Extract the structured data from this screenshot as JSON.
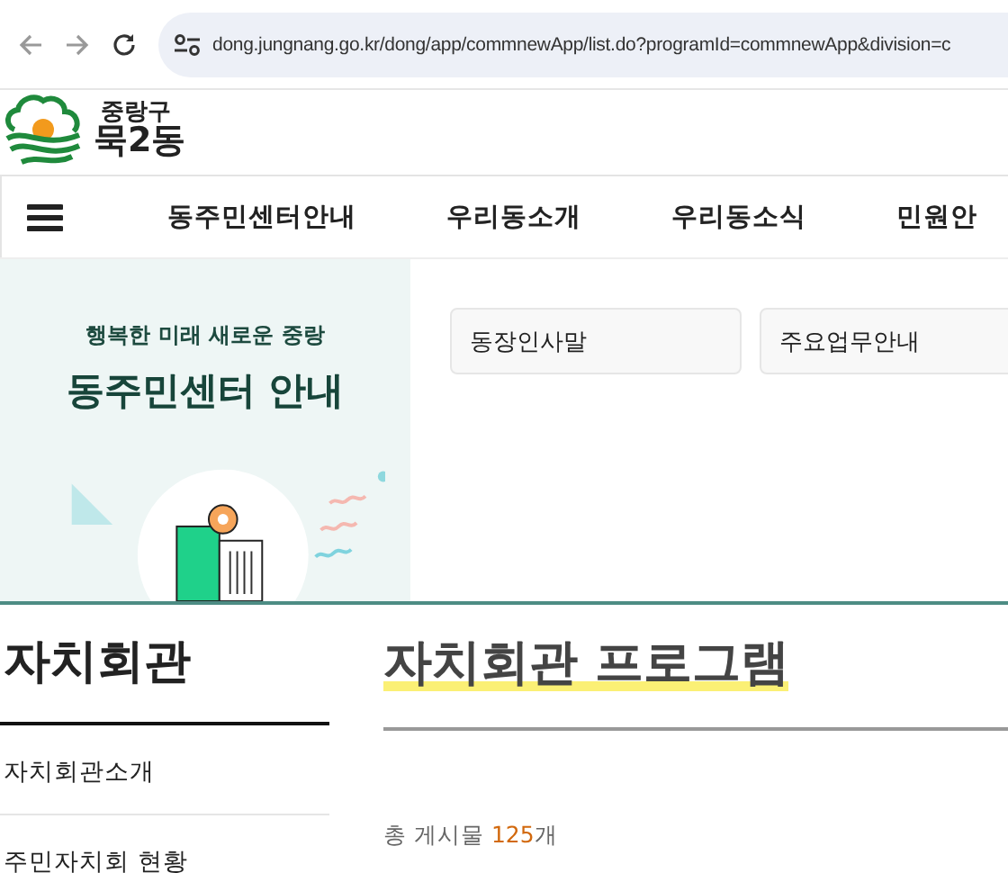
{
  "browser": {
    "url": "dong.jungnang.go.kr/dong/app/commnewApp/list.do?programId=commnewApp&division=c"
  },
  "header": {
    "district": "중랑구",
    "dong": "묵2동"
  },
  "nav": {
    "items": [
      "동주민센터안내",
      "우리동소개",
      "우리동소식",
      "민원안"
    ]
  },
  "banner": {
    "subtitle": "행복한 미래 새로운 중랑",
    "title": "동주민센터 안내",
    "links": [
      "동장인사말",
      "주요업무안내"
    ]
  },
  "sidebar": {
    "title": "자치회관",
    "items": [
      "자치회관소개",
      "주민자치회 현황"
    ]
  },
  "main": {
    "title": "자치회관 프로그램",
    "count_prefix": "총 게시물",
    "count": "125",
    "count_suffix": "개"
  }
}
